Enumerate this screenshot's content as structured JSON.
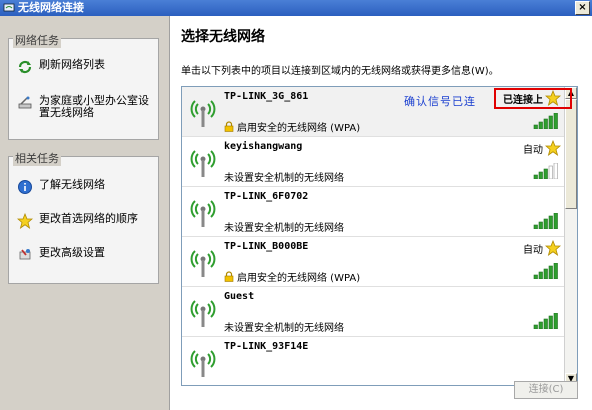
{
  "window": {
    "title": "无线网络连接",
    "close_glyph": "×"
  },
  "left": {
    "network_tasks": {
      "header": "网络任务",
      "items": [
        {
          "label": "刷新网络列表",
          "icon": "refresh-icon"
        },
        {
          "label": "为家庭或小型办公室设置无线网络",
          "icon": "setup-wizard-icon"
        }
      ]
    },
    "related_tasks": {
      "header": "相关任务",
      "items": [
        {
          "label": "了解无线网络",
          "icon": "info-icon"
        },
        {
          "label": "更改首选网络的顺序",
          "icon": "star-icon"
        },
        {
          "label": "更改高级设置",
          "icon": "settings-icon"
        }
      ]
    }
  },
  "main": {
    "title": "选择无线网络",
    "description": "单击以下列表中的项目以连接到区域内的无线网络或获得更多信息(W)。",
    "annotation": "确认信号已连",
    "connect_button": "连接(C)",
    "networks": [
      {
        "ssid": "TP-LINK_3G_861",
        "status": "已连接上",
        "security": "启用安全的无线网络 (WPA)",
        "secured": true,
        "signal": 5
      },
      {
        "ssid": "keyishangwang",
        "status": "自动",
        "security": "未设置安全机制的无线网络",
        "secured": false,
        "signal": 3
      },
      {
        "ssid": "TP-LINK_6F0702",
        "status": "",
        "security": "未设置安全机制的无线网络",
        "secured": false,
        "signal": 5
      },
      {
        "ssid": "TP-LINK_B000BE",
        "status": "自动",
        "security": "启用安全的无线网络 (WPA)",
        "secured": true,
        "signal": 5
      },
      {
        "ssid": "Guest",
        "status": "",
        "security": "未设置安全机制的无线网络",
        "secured": false,
        "signal": 5
      },
      {
        "ssid": "TP-LINK_93F14E",
        "status": "",
        "security": "",
        "secured": false,
        "signal": 0
      }
    ]
  },
  "colors": {
    "titlebar": "#2b5fbf",
    "accent": "#1a3fd0",
    "annotation_box": "#e00000",
    "signal_green": "#2f9e2f"
  }
}
